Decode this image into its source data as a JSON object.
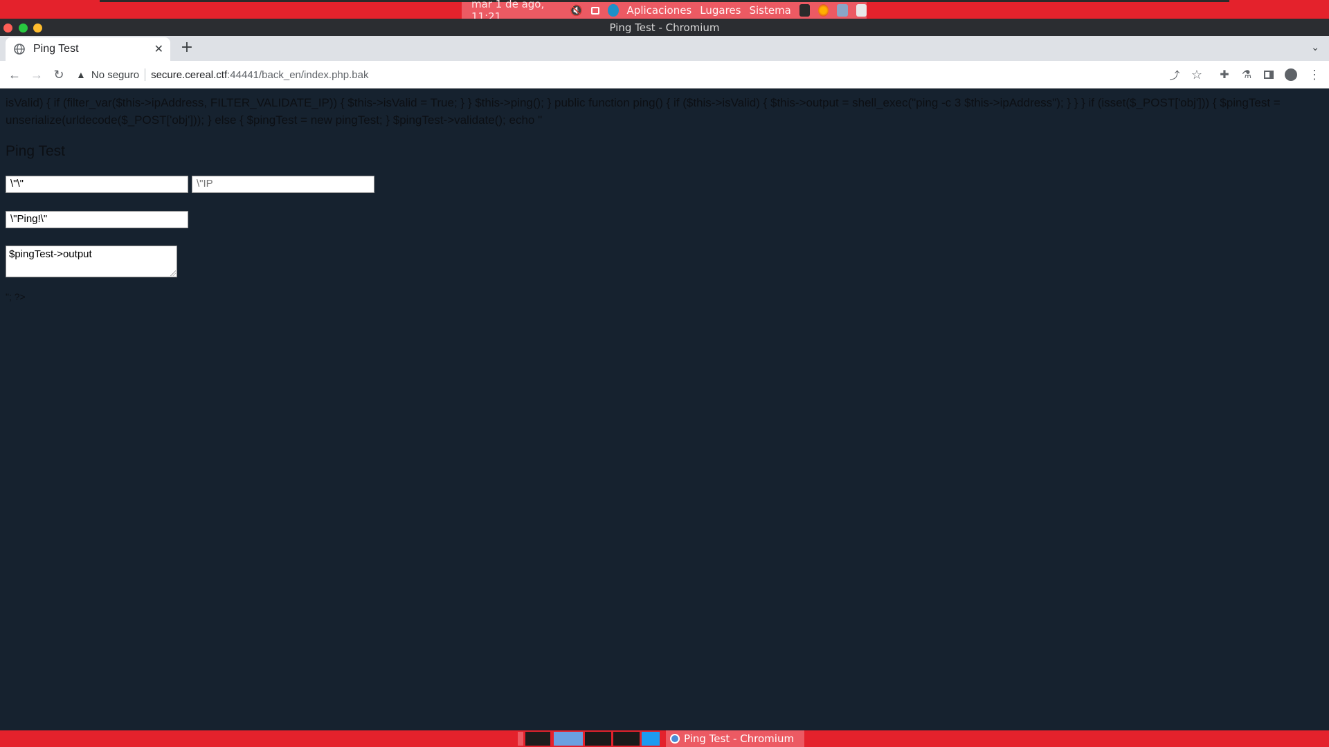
{
  "desktop": {
    "clock": "mar  1 de ago, 11:21",
    "menus": [
      "Aplicaciones",
      "Lugares",
      "Sistema"
    ],
    "accent": "#e4222c"
  },
  "window": {
    "title": "Ping Test - Chromium"
  },
  "browser": {
    "tab_title": "Ping Test",
    "tab_close_icon": "close-icon",
    "new_tab_label": "+",
    "security_label": "No seguro",
    "url_host": "secure.cereal.ctf",
    "url_rest": ":44441/back_en/index.php.bak",
    "icons": [
      "back-icon",
      "forward-icon",
      "reload-icon",
      "warning-icon",
      "share-icon",
      "star-icon",
      "extensions-icon",
      "flask-icon",
      "side-panel-icon",
      "profile-icon",
      "menu-icon"
    ]
  },
  "page": {
    "leaked_code": "isValid) { if (filter_var($this->ipAddress, FILTER_VALIDATE_IP)) { $this->isValid = True; } } $this->ping(); } public function ping() { if ($this->isValid) { $this->output = shell_exec(\"ping -c 3 $this->ipAddress\"); } } } if (isset($_POST['obj'])) { $pingTest = unserialize(urldecode($_POST['obj'])); } else { $pingTest = new pingTest; } $pingTest->validate(); echo \"",
    "heading": "Ping Test",
    "field_one_value": "\\\"\\\"",
    "field_two_placeholder": "\\\"IP",
    "submit_value": "\\\"Ping!\\\"",
    "output_text": "$pingTest->output",
    "trailing_text": "\"; ?>"
  },
  "taskbar": {
    "active_task_label": "Ping Test - Chromium"
  }
}
